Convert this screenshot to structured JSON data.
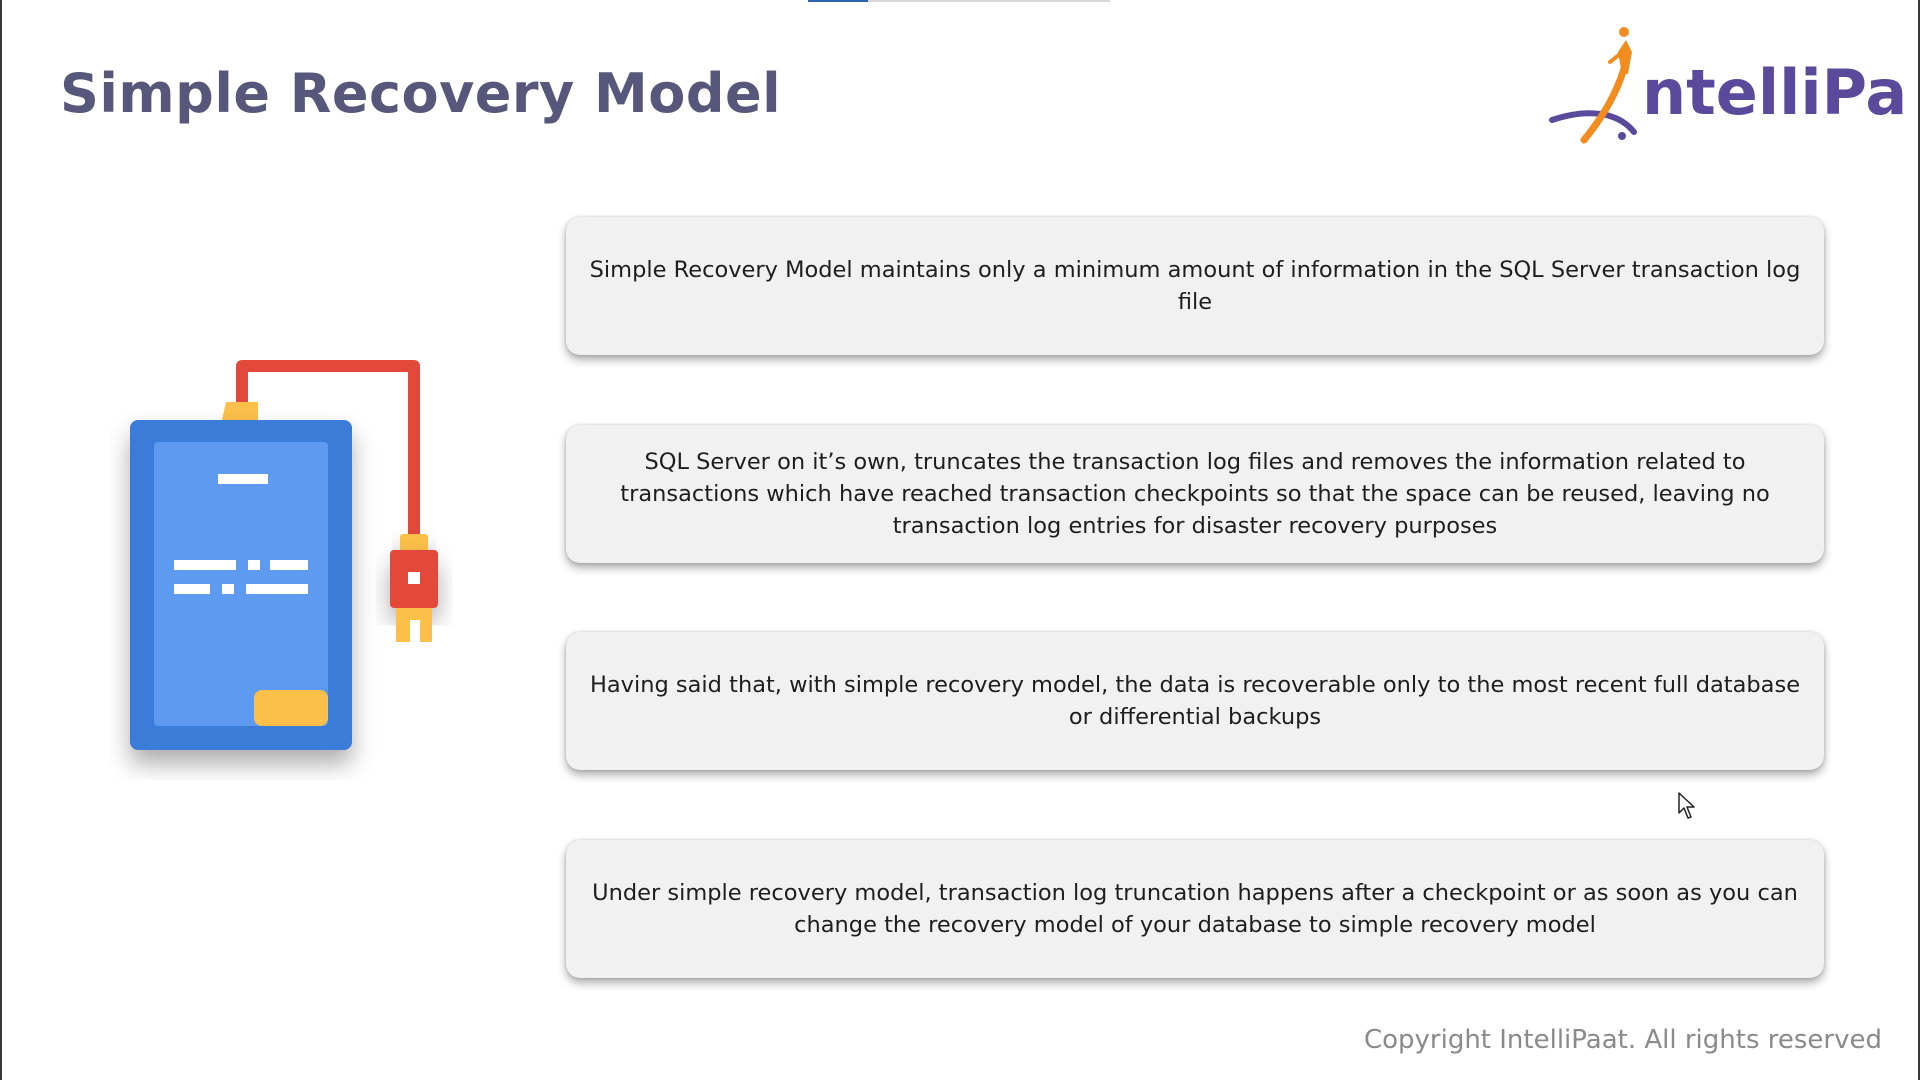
{
  "slide": {
    "title": "Simple Recovery Model",
    "logo_text": "IntelliPaat",
    "cards": [
      {
        "text": "Simple Recovery Model maintains only a minimum amount of information in the SQL Server transaction log file"
      },
      {
        "text": "SQL Server on it’s own, truncates the transaction log files and removes the information related to transactions which have reached transaction checkpoints so that the space can be reused, leaving no transaction log entries for disaster recovery purposes"
      },
      {
        "text": "Having said that, with simple recovery model, the data is recoverable only to the most recent full database or differential backups"
      },
      {
        "text": "Under simple recovery model, transaction log truncation happens after a checkpoint or as soon as you can change the recovery model of your database to simple recovery model"
      }
    ],
    "copyright": "Copyright IntelliPaat. All rights reserved"
  },
  "colors": {
    "title": "#56577a",
    "logo_purple": "#5a4a9c",
    "logo_orange": "#f28c1e",
    "device_blue_dark": "#3b7bd8",
    "device_blue_light": "#5e9af0",
    "device_accent_yellow": "#fbbf4a",
    "cable_red": "#e2493b",
    "card_background": "#f1f1f1",
    "copyright": "#8a8a8a"
  },
  "icons": {
    "illustration": "external-hard-drive-icon",
    "cursor": "mouse-pointer-icon"
  }
}
